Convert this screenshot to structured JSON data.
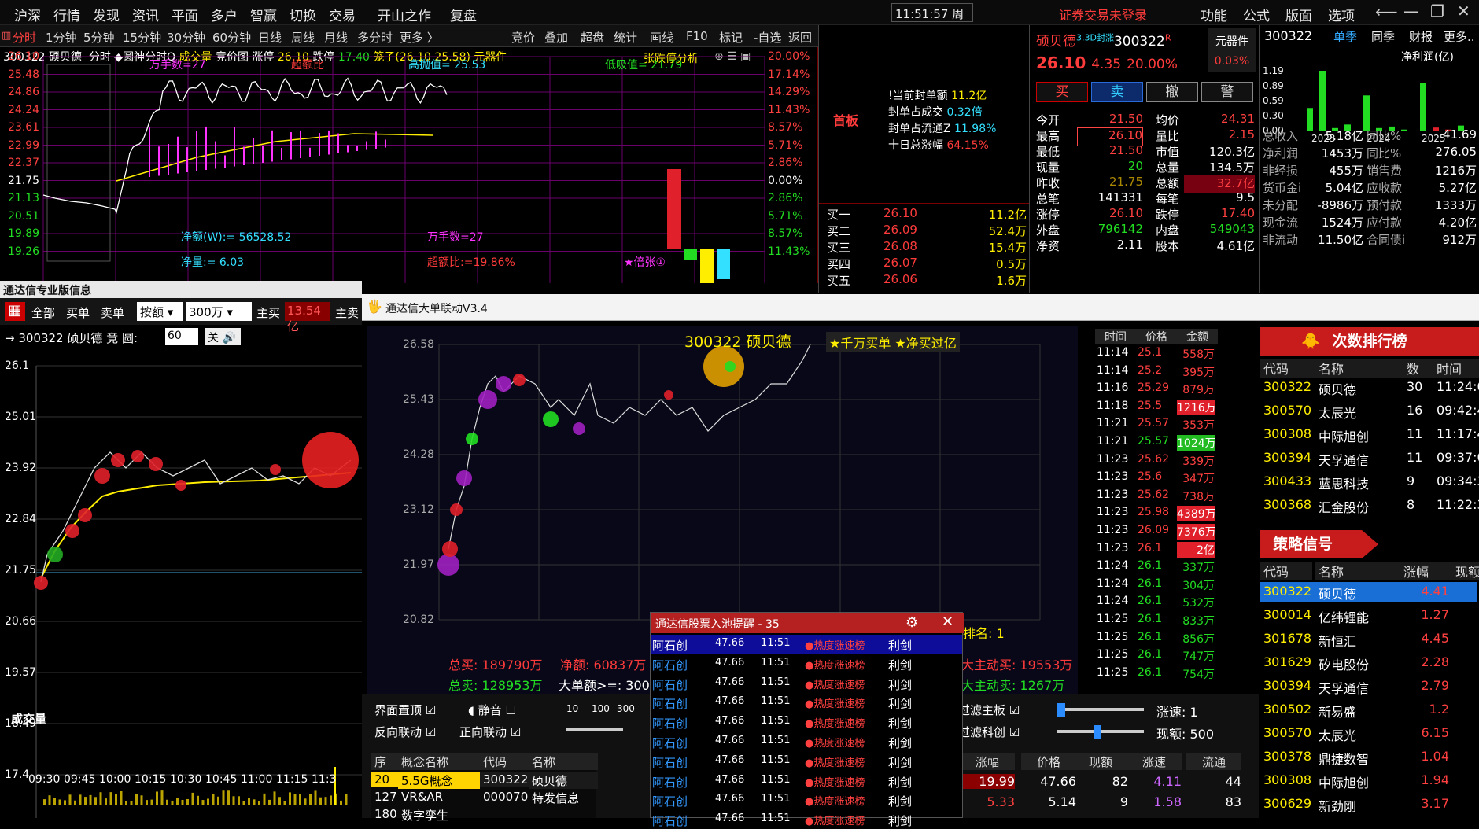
{
  "menu": {
    "items": [
      "沪深",
      "行情",
      "发现",
      "资讯",
      "平面",
      "多户",
      "智赢",
      "切换",
      "交易",
      "开山之作",
      "复盘"
    ],
    "clock": "11:51:57 周四",
    "warning": "证券交易未登录",
    "right": [
      "功能",
      "公式",
      "版面",
      "选项"
    ]
  },
  "toolbar": {
    "left": [
      "分时",
      "1分钟",
      "5分钟",
      "15分钟",
      "30分钟",
      "60分钟",
      "日线",
      "周线",
      "月线",
      "多分时",
      "更多 〉"
    ],
    "right": [
      "竞价",
      "叠加",
      "超盘",
      "统计",
      "画线",
      "F10",
      "标记",
      "-自选",
      "返回"
    ]
  },
  "chart_header": {
    "code": "300322 硕贝德",
    "mode": "分时",
    "fn": "◆圆神分时Q",
    "vol": "成交量",
    "jj": "竞价图",
    "zt_lbl": "涨停",
    "zt": "26.10",
    "dt_lbl": "跌停",
    "dt": "17.40",
    "note": "笼子(26.10 25.58)",
    "tool": "元器件",
    "analysis": "张跌停分析"
  },
  "chart_left_y": [
    "26.10",
    "25.48",
    "24.86",
    "24.24",
    "23.61",
    "22.99",
    "22.37",
    "21.75",
    "21.13",
    "20.51",
    "19.89",
    "19.26"
  ],
  "chart_right_y": [
    "20.00%",
    "17.14%",
    "14.29%",
    "11.43%",
    "8.57%",
    "5.71%",
    "2.86%",
    "0.00%",
    "2.86%",
    "5.71%",
    "8.57%",
    "11.43%"
  ],
  "chart_labels": {
    "wan": "万手数=27",
    "chao": "超额比",
    "gao": "高抛值= 25.53",
    "di": "低吸值= 21.79",
    "jinge": "净额(W):= 56528.52",
    "wan2": "万手数=27",
    "jingliang": "净量:= 6.03",
    "chao2": "超额比:=19.86%",
    "beizhang": "★倍张①"
  },
  "seal": {
    "first": "首板",
    "l1": "!当前封单额",
    "v1": "11.2亿",
    "l2": "封单占成交",
    "v2": "0.32倍",
    "l3": "封单占流通Z",
    "v3": "11.98%",
    "l4": "十日总涨幅",
    "v4": "64.15%"
  },
  "bids": [
    {
      "n": "买一",
      "p": "26.10",
      "v": "11.2亿"
    },
    {
      "n": "买二",
      "p": "26.09",
      "v": "52.4万"
    },
    {
      "n": "买三",
      "p": "26.08",
      "v": "15.4万"
    },
    {
      "n": "买四",
      "p": "26.07",
      "v": "0.5万"
    },
    {
      "n": "买五",
      "p": "26.06",
      "v": "1.6万"
    }
  ],
  "quote": {
    "name": "硕贝德",
    "tag": "3.3D封涨",
    "code": "300322",
    "r": "R",
    "price": "26.10",
    "chg": "4.35",
    "pct": "20.00%",
    "sector": "元器件",
    "sector_pct": "0.03%",
    "btns": [
      "买",
      "卖",
      "撤",
      "警"
    ]
  },
  "stats": [
    [
      "今开",
      "21.50",
      "均价",
      "24.31"
    ],
    [
      "最高",
      "26.10",
      "量比",
      "2.15"
    ],
    [
      "最低",
      "21.50",
      "市值",
      "120.3亿"
    ],
    [
      "现量",
      "20",
      "总量",
      "134.5万"
    ],
    [
      "昨收",
      "21.75",
      "总额",
      "32.7亿"
    ],
    [
      "总笔",
      "141331",
      "每笔",
      "9.5"
    ],
    [
      "涨停",
      "26.10",
      "跌停",
      "17.40"
    ],
    [
      "外盘",
      "796142",
      "内盘",
      "549043"
    ],
    [
      "净资",
      "2.11",
      "股本",
      "4.61亿"
    ]
  ],
  "fin": {
    "code": "300322",
    "tabs": [
      "单季",
      "同季",
      "财报",
      "更多.."
    ],
    "title": "净利润(亿)",
    "y": [
      "1.19",
      "0.89",
      "0.59",
      "0.30",
      "0.00"
    ],
    "years": [
      "2023",
      "2024",
      "2025"
    ],
    "bars": [
      0.45,
      1.19,
      0.05,
      0.12,
      0.7,
      0.05,
      0.08,
      0.02,
      0.95,
      0.06,
      0.02,
      0.1
    ],
    "rows": [
      [
        "总收入",
        "5.18亿",
        "同比%",
        "41.69"
      ],
      [
        "净利润",
        "1453万",
        "同比%",
        "276.05"
      ],
      [
        "非经损",
        "455万",
        "销售费",
        "1216万"
      ],
      [
        "货币金i",
        "5.04亿",
        "应收款",
        "5.27亿"
      ],
      [
        "未分配",
        "-8986万",
        "预付款",
        "1333万"
      ],
      [
        "现金流",
        "1524万",
        "应付款",
        "4.20亿"
      ],
      [
        "非流动",
        "11.50亿",
        "合同债i",
        "912万"
      ]
    ]
  },
  "left_win": {
    "title": "通达信专业版信息",
    "tabs": [
      "全部",
      "买单",
      "卖单"
    ],
    "sel1": "按额",
    "sel2": "300万",
    "zhu": "主买",
    "zhu_val": "13.54亿",
    "zhu2": "主卖",
    "stock": "→ 300322 硕贝德",
    "jing": "竞",
    "yuan": "圆:",
    "yuan_val": "60",
    "guan": "关",
    "y": [
      "26.1",
      "25.01",
      "23.92",
      "22.84",
      "21.75",
      "20.66",
      "19.57",
      "18.49",
      "17.4"
    ],
    "vol_lbl": "成交量",
    "x": [
      "09:30",
      "09:45",
      "10:00",
      "10:15",
      "10:30",
      "10:45",
      "11:00",
      "11:15",
      "11:3"
    ]
  },
  "big_win": {
    "title": "通达信大单联动V3.4",
    "stock": "300322 硕贝德",
    "badge": "★千万买单 ★净买过亿",
    "y": [
      "26.58",
      "25.43",
      "24.28",
      "23.12",
      "21.97",
      "20.82"
    ],
    "zongmai": "总买: 189790万",
    "jinge": "净额: 60837万",
    "zongmai2": "总卖: 128953万",
    "dade": "大单额>=: 300",
    "paiming": "排名: 1",
    "dazhumai": "大主动买: 19553万",
    "dazhumai2": "大主动卖: 1267万",
    "ctrl": {
      "jmzd": "界面置顶",
      "jy": "静音",
      "fxld": "反向联动",
      "zxld": "正向联动",
      "scale": [
        "10",
        "100",
        "300"
      ],
      "glzb": "过滤主板",
      "glkb": "过滤科创",
      "zs": "涨速:",
      "zs_v": "1",
      "xe": "现额:",
      "xe_v": "500"
    }
  },
  "ticks": {
    "hdr": [
      "时间",
      "价格",
      "金额"
    ],
    "rows": [
      [
        "11:14",
        "25.1",
        "558万",
        "r"
      ],
      [
        "11:14",
        "25.2",
        "395万",
        "r"
      ],
      [
        "11:16",
        "25.29",
        "879万",
        "r"
      ],
      [
        "11:18",
        "25.5",
        "1216万",
        "R"
      ],
      [
        "11:21",
        "25.57",
        "353万",
        "r"
      ],
      [
        "11:21",
        "25.57",
        "1024万",
        "G"
      ],
      [
        "11:23",
        "25.62",
        "339万",
        "r"
      ],
      [
        "11:23",
        "25.6",
        "347万",
        "r"
      ],
      [
        "11:23",
        "25.62",
        "738万",
        "r"
      ],
      [
        "11:23",
        "25.98",
        "4389万",
        "R"
      ],
      [
        "11:23",
        "26.09",
        "7376万",
        "R"
      ],
      [
        "11:23",
        "26.1",
        "2亿",
        "R"
      ],
      [
        "11:24",
        "26.1",
        "337万",
        "g"
      ],
      [
        "11:24",
        "26.1",
        "304万",
        "g"
      ],
      [
        "11:24",
        "26.1",
        "532万",
        "g"
      ],
      [
        "11:25",
        "26.1",
        "833万",
        "g"
      ],
      [
        "11:25",
        "26.1",
        "856万",
        "g"
      ],
      [
        "11:25",
        "26.1",
        "747万",
        "g"
      ],
      [
        "11:25",
        "26.1",
        "754万",
        "g"
      ]
    ]
  },
  "rank": {
    "title": "次数排行榜",
    "hdr": [
      "代码",
      "名称",
      "数",
      "时间"
    ],
    "rows": [
      [
        "300322",
        "硕贝德",
        "30",
        "11:24:0"
      ],
      [
        "300570",
        "太辰光",
        "16",
        "09:42:4"
      ],
      [
        "300308",
        "中际旭创",
        "11",
        "11:17:4"
      ],
      [
        "300394",
        "天孚通信",
        "11",
        "09:37:0"
      ],
      [
        "300433",
        "蓝思科技",
        "9",
        "09:34:3"
      ],
      [
        "300368",
        "汇金股份",
        "8",
        "11:22:3"
      ]
    ]
  },
  "signal": {
    "title": "策略信号",
    "hdr": [
      "代码",
      "名称",
      "涨幅",
      "现额"
    ],
    "rows": [
      [
        "300322",
        "硕贝德",
        "4.41"
      ],
      [
        "300014",
        "亿纬锂能",
        "1.27"
      ],
      [
        "301678",
        "新恒汇",
        "4.45"
      ],
      [
        "301629",
        "矽电股份",
        "2.28"
      ],
      [
        "300394",
        "天孚通信",
        "2.79"
      ],
      [
        "300502",
        "新易盛",
        "1.2"
      ],
      [
        "300570",
        "太辰光",
        "6.15"
      ],
      [
        "300378",
        "鼎捷数智",
        "1.04"
      ],
      [
        "300308",
        "中际旭创",
        "1.94"
      ],
      [
        "300629",
        "新劲刚",
        "3.17"
      ]
    ]
  },
  "concept": {
    "hdr": [
      "序",
      "概念名称",
      "代码",
      "名称"
    ],
    "rows": [
      [
        "20",
        "5.5G概念",
        "300322",
        "硕贝德"
      ],
      [
        "127",
        "VR&AR",
        "000070",
        "特发信息"
      ],
      [
        "180",
        "数字孪生",
        "",
        " "
      ]
    ]
  },
  "pool": {
    "title": "通达信股票入池提醒 - 35",
    "rows": [
      [
        "阿石创",
        "47.66",
        "11:51",
        "●热度涨速榜",
        "利剑"
      ],
      [
        "阿石创",
        "47.66",
        "11:51",
        "●热度涨速榜",
        "利剑"
      ],
      [
        "阿石创",
        "47.66",
        "11:51",
        "●热度涨速榜",
        "利剑"
      ],
      [
        "阿石创",
        "47.66",
        "11:51",
        "●热度涨速榜",
        "利剑"
      ],
      [
        "阿石创",
        "47.66",
        "11:51",
        "●热度涨速榜",
        "利剑"
      ],
      [
        "阿石创",
        "47.66",
        "11:51",
        "●热度涨速榜",
        "利剑"
      ],
      [
        "阿石创",
        "47.66",
        "11:51",
        "●热度涨速榜",
        "利剑"
      ],
      [
        "阿石创",
        "47.66",
        "11:51",
        "●热度涨速榜",
        "利剑"
      ],
      [
        "阿石创",
        "47.66",
        "11:51",
        "●热度涨速榜",
        "利剑"
      ],
      [
        "阿石创",
        "47.66",
        "11:51",
        "●热度涨速榜",
        "利剑"
      ]
    ]
  },
  "bottom_tbl": {
    "hdr": [
      "涨幅",
      "价格",
      "现额",
      "涨速",
      "流通"
    ],
    "rows": [
      [
        "19.99",
        "47.66",
        "82",
        "4.11",
        "44"
      ],
      [
        "5.33",
        "5.14",
        "9",
        "1.58",
        "83"
      ]
    ]
  }
}
